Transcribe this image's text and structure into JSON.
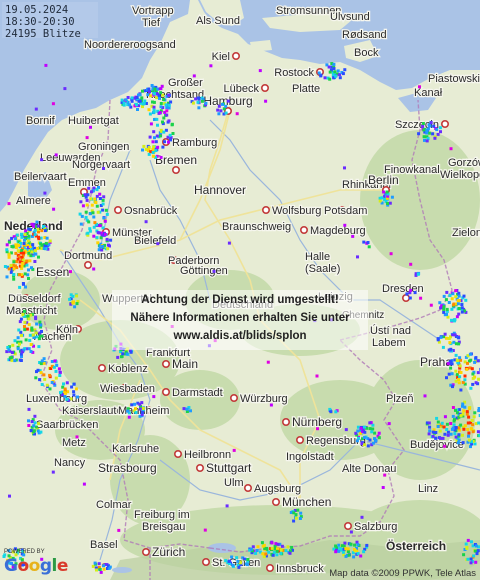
{
  "stamp": {
    "date": "19.05.2024",
    "time_range": "18:30-20:30",
    "count": "24195 Blitze"
  },
  "notice": {
    "line1": "Achtung der Dienst wird umgestellt!",
    "line2": "Nähere Informationen erhalten Sie unter",
    "line3": "www.aldis.at/blids/splon"
  },
  "attribution": "Map data ©2009 PPWK, Tele Atlas",
  "logo": {
    "powered_by": "POWERED BY",
    "wordmark": "Google"
  },
  "colors": {
    "sea": "#aac3e6",
    "land": "#e7ecd4",
    "forest": "#c8dcae",
    "border": "#b07ab8",
    "city_fill": "#ffffff",
    "city_ring": "#c23a3a"
  },
  "lightning_palette": [
    "#e000e0",
    "#c000ff",
    "#6a2cff",
    "#2b4bff",
    "#1e9bff",
    "#14d7e6",
    "#1bd24a",
    "#d4ee18",
    "#ffd400",
    "#ff8a00",
    "#ff2a00"
  ],
  "places": [
    {
      "name": "Vortrapp"
    },
    {
      "name": "Tief"
    },
    {
      "name": "Als Sund"
    },
    {
      "name": "Stromsunnen"
    },
    {
      "name": "Ulvsund"
    },
    {
      "name": "Rødsand"
    },
    {
      "name": "Noordereroogsand"
    },
    {
      "name": "Kiel"
    },
    {
      "name": "Bock"
    },
    {
      "name": "Rostock"
    },
    {
      "name": "Piastowski"
    },
    {
      "name": "Kanał"
    },
    {
      "name": "Großer"
    },
    {
      "name": "Knechtsand"
    },
    {
      "name": "Lübeck"
    },
    {
      "name": "Platte"
    },
    {
      "name": "Hamburg"
    },
    {
      "name": "Bornif"
    },
    {
      "name": "Huibertgat"
    },
    {
      "name": "Szczecin"
    },
    {
      "name": "Leeuwarden"
    },
    {
      "name": "Groningen"
    },
    {
      "name": "Ramburg"
    },
    {
      "name": "Bremen"
    },
    {
      "name": "Gorzów"
    },
    {
      "name": "Wielkopo"
    },
    {
      "name": "Beilervaart"
    },
    {
      "name": "Norgervaart"
    },
    {
      "name": "Finowkanal"
    },
    {
      "name": "Emmen"
    },
    {
      "name": "Rhinkanal"
    },
    {
      "name": "Berlin"
    },
    {
      "name": "Almere"
    },
    {
      "name": "Osnabrück"
    },
    {
      "name": "Hannover"
    },
    {
      "name": "Wolfsburg"
    },
    {
      "name": "Potsdam"
    },
    {
      "name": "Nederland"
    },
    {
      "name": "Münster"
    },
    {
      "name": "Braunschweig"
    },
    {
      "name": "Magdeburg"
    },
    {
      "name": "Bielefeld"
    },
    {
      "name": "Zielona"
    },
    {
      "name": "Dortmund"
    },
    {
      "name": "Paderborn"
    },
    {
      "name": "Göttingen"
    },
    {
      "name": "Halle"
    },
    {
      "name": "(Saale)"
    },
    {
      "name": "Essen"
    },
    {
      "name": "Leipzig"
    },
    {
      "name": "Dresden"
    },
    {
      "name": "Düsseldorf"
    },
    {
      "name": "Wuppertal"
    },
    {
      "name": "Deutschland"
    },
    {
      "name": "Maastricht"
    },
    {
      "name": "Köln"
    },
    {
      "name": "Chemnitz"
    },
    {
      "name": "Ústí nad"
    },
    {
      "name": "Labem"
    },
    {
      "name": "Aachen"
    },
    {
      "name": "Frankfurt"
    },
    {
      "name": "Koblenz"
    },
    {
      "name": "Main"
    },
    {
      "name": "Praha"
    },
    {
      "name": "Wiesbaden"
    },
    {
      "name": "Luxembourg"
    },
    {
      "name": "Darmstadt"
    },
    {
      "name": "Würzburg"
    },
    {
      "name": "Plzeň"
    },
    {
      "name": "Kaiserslautern"
    },
    {
      "name": "Mannheim"
    },
    {
      "name": "Saarbrücken"
    },
    {
      "name": "Nürnberg"
    },
    {
      "name": "Metz"
    },
    {
      "name": "Karlsruhe"
    },
    {
      "name": "Heilbronn"
    },
    {
      "name": "Regensburg"
    },
    {
      "name": "Nancy"
    },
    {
      "name": "Ingolstadt"
    },
    {
      "name": "Strasbourg"
    },
    {
      "name": "Stuttgart"
    },
    {
      "name": "Alte Donau"
    },
    {
      "name": "Ulm"
    },
    {
      "name": "Augsburg"
    },
    {
      "name": "Linz"
    },
    {
      "name": "Colmar"
    },
    {
      "name": "München"
    },
    {
      "name": "Freiburg im"
    },
    {
      "name": "Breisgau"
    },
    {
      "name": "Salzburg"
    },
    {
      "name": "Basel"
    },
    {
      "name": "Zürich"
    },
    {
      "name": "Österreich"
    },
    {
      "name": "St. Gallen"
    },
    {
      "name": "Innsbruck"
    },
    {
      "name": "Budějovice"
    }
  ]
}
